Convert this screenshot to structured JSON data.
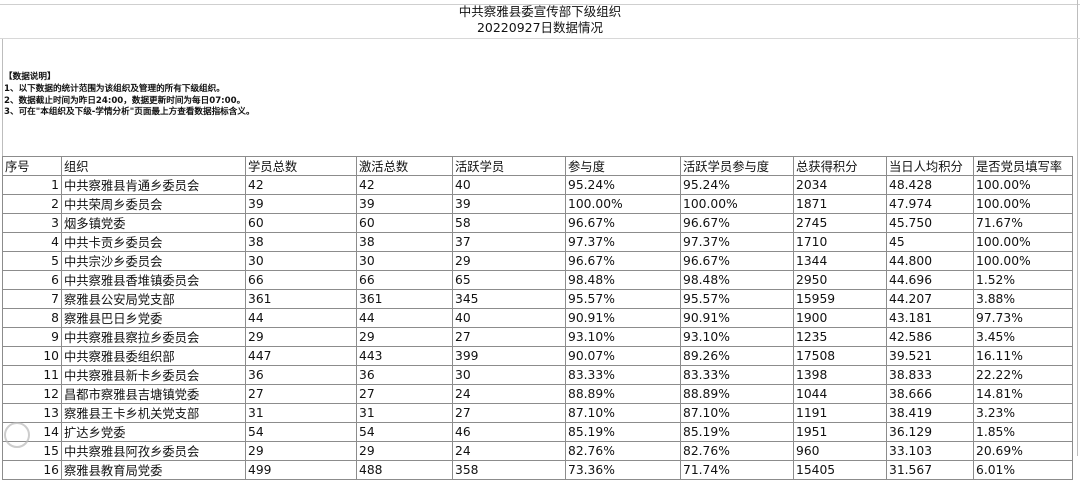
{
  "title": "中共察雅县委宣传部下级组织",
  "subtitle": "20220927日数据情况",
  "notes": {
    "heading": "【数据说明】",
    "lines": [
      "1、以下数据的统计范围为该组织及管理的所有下级组织。",
      "2、数据截止时间为昨日24:00，数据更新时间为每日07:00。",
      "3、可在\"本组织及下级-学情分析\"页面最上方查看数据指标含义。"
    ]
  },
  "table": {
    "headers": [
      "序号",
      "组织",
      "学员总数",
      "激活总数",
      "活跃学员",
      "参与度",
      "活跃学员参与度",
      "总获得积分",
      "当日人均积分",
      "是否党员填写率"
    ],
    "rows": [
      [
        "1",
        "中共察雅县肯通乡委员会",
        "42",
        "42",
        "40",
        "95.24%",
        "95.24%",
        "2034",
        "48.428",
        "100.00%"
      ],
      [
        "2",
        "中共荣周乡委员会",
        "39",
        "39",
        "39",
        "100.00%",
        "100.00%",
        "1871",
        "47.974",
        "100.00%"
      ],
      [
        "3",
        "烟多镇党委",
        "60",
        "60",
        "58",
        "96.67%",
        "96.67%",
        "2745",
        "45.750",
        "71.67%"
      ],
      [
        "4",
        "中共卡贡乡委员会",
        "38",
        "38",
        "37",
        "97.37%",
        "97.37%",
        "1710",
        "45",
        "100.00%"
      ],
      [
        "5",
        "中共宗沙乡委员会",
        "30",
        "30",
        "29",
        "96.67%",
        "96.67%",
        "1344",
        "44.800",
        "100.00%"
      ],
      [
        "6",
        "中共察雅县香堆镇委员会",
        "66",
        "66",
        "65",
        "98.48%",
        "98.48%",
        "2950",
        "44.696",
        "1.52%"
      ],
      [
        "7",
        "察雅县公安局党支部",
        "361",
        "361",
        "345",
        "95.57%",
        "95.57%",
        "15959",
        "44.207",
        "3.88%"
      ],
      [
        "8",
        "察雅县巴日乡党委",
        "44",
        "44",
        "40",
        "90.91%",
        "90.91%",
        "1900",
        "43.181",
        "97.73%"
      ],
      [
        "9",
        "中共察雅县察拉乡委员会",
        "29",
        "29",
        "27",
        "93.10%",
        "93.10%",
        "1235",
        "42.586",
        "3.45%"
      ],
      [
        "10",
        "中共察雅县委组织部",
        "447",
        "443",
        "399",
        "90.07%",
        "89.26%",
        "17508",
        "39.521",
        "16.11%"
      ],
      [
        "11",
        "中共察雅县新卡乡委员会",
        "36",
        "36",
        "30",
        "83.33%",
        "83.33%",
        "1398",
        "38.833",
        "22.22%"
      ],
      [
        "12",
        "昌都市察雅县吉塘镇党委",
        "27",
        "27",
        "24",
        "88.89%",
        "88.89%",
        "1044",
        "38.666",
        "14.81%"
      ],
      [
        "13",
        "察雅县王卡乡机关党支部",
        "31",
        "31",
        "27",
        "87.10%",
        "87.10%",
        "1191",
        "38.419",
        "3.23%"
      ],
      [
        "14",
        "扩达乡党委",
        "54",
        "54",
        "46",
        "85.19%",
        "85.19%",
        "1951",
        "36.129",
        "1.85%"
      ],
      [
        "15",
        "中共察雅县阿孜乡委员会",
        "29",
        "29",
        "24",
        "82.76%",
        "82.76%",
        "960",
        "33.103",
        "20.69%"
      ],
      [
        "16",
        "察雅县教育局党委",
        "499",
        "488",
        "358",
        "73.36%",
        "71.74%",
        "15405",
        "31.567",
        "6.01%"
      ]
    ]
  }
}
